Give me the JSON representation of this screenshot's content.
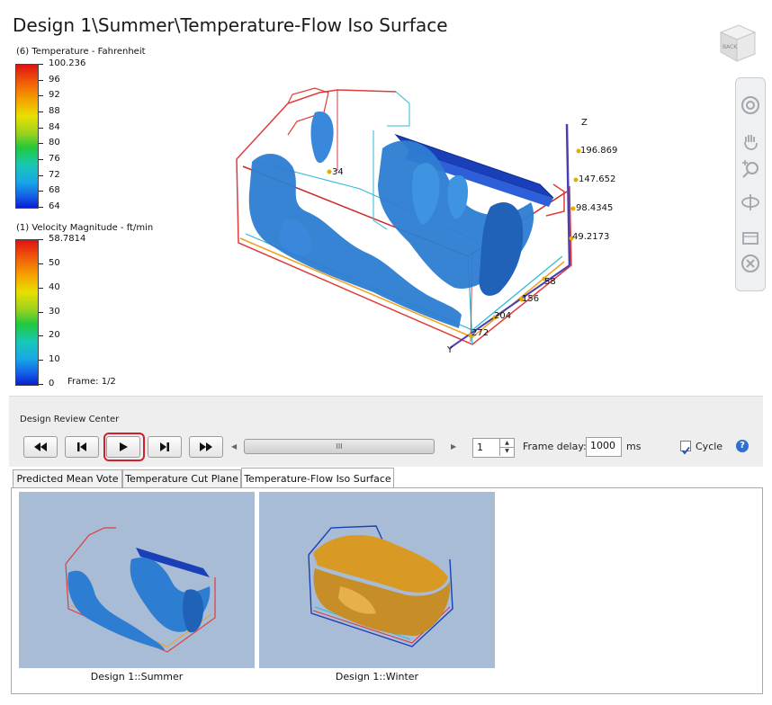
{
  "title": "Design 1\\Summer\\Temperature-Flow Iso Surface",
  "legend_temperature": {
    "title": "(6) Temperature - Fahrenheit",
    "ticks": [
      "100.236",
      "96",
      "92",
      "88",
      "84",
      "80",
      "76",
      "72",
      "68",
      "64"
    ]
  },
  "legend_velocity": {
    "title": "(1) Velocity Magnitude - ft/min",
    "ticks": [
      "58.7814",
      "50",
      "40",
      "30",
      "20",
      "10",
      "0"
    ]
  },
  "frame_label": "Frame: 1/2",
  "axis_labels": {
    "z": "Z",
    "y": "Y",
    "z_values": [
      "196.869",
      "147.652",
      "98.4345",
      "49.2173"
    ],
    "y_values": [
      "58",
      "156",
      "204",
      "272"
    ],
    "x_value": "34"
  },
  "drc": {
    "title": "Design Review Center",
    "frame_value": "1",
    "frame_delay_label": "Frame delay:",
    "frame_delay_value": "1000",
    "frame_delay_unit": "ms",
    "cycle_label": "Cycle",
    "cycle_checked": true,
    "scroll_thumb_glyph": "III"
  },
  "tabs": [
    {
      "label": "Predicted Mean Vote",
      "active": false
    },
    {
      "label": "Temperature Cut Plane",
      "active": false
    },
    {
      "label": "Temperature-Flow Iso Surface",
      "active": true
    }
  ],
  "thumbnails": [
    {
      "caption": "Design 1::Summer"
    },
    {
      "caption": "Design 1::Winter"
    }
  ],
  "viewcube_label": "BACK",
  "colors": {
    "iso_surface": "#2d7dd2",
    "winter_surface": "#d99a25",
    "thumb_bg": "#a8bcd6",
    "play_highlight": "#d1202a",
    "help": "#2f6fd0"
  },
  "icons": [
    "viewcube-icon",
    "steering-wheel-icon",
    "pan-icon",
    "zoom-icon",
    "orbit-icon",
    "look-icon",
    "center-icon",
    "help-icon"
  ]
}
